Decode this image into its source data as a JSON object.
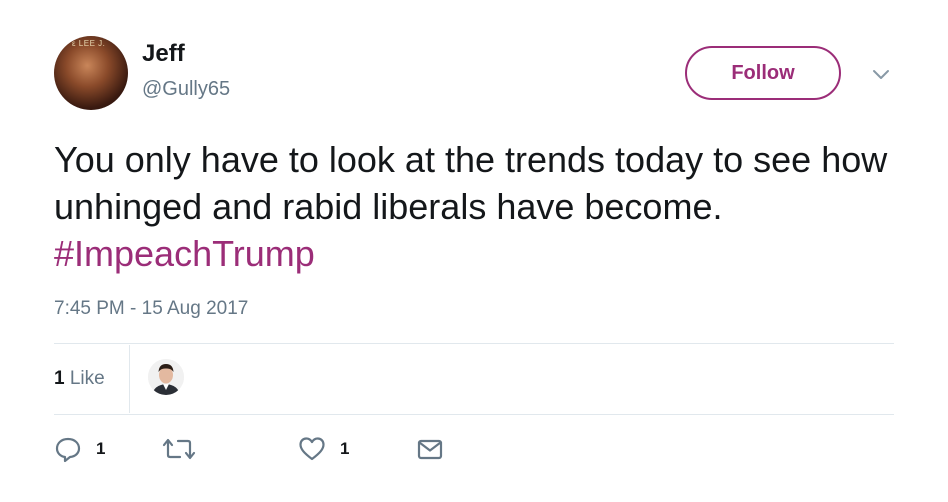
{
  "author": {
    "name": "Jeff",
    "handle": "@Gully65",
    "avatar_text": "ε LEE J."
  },
  "follow_label": "Follow",
  "tweet": {
    "text": "You only have to look at the trends today to see how unhinged and rabid liberals have become.",
    "hashtag": "#ImpeachTrump",
    "timestamp": "7:45 PM - 15 Aug 2017"
  },
  "likes": {
    "count": "1",
    "label": "Like"
  },
  "actions": {
    "reply_count": "1",
    "like_count": "1"
  },
  "colors": {
    "accent": "#9b2d78",
    "text": "#14171a",
    "muted": "#657786",
    "divider": "#e1e8ed"
  },
  "icons": {
    "caret": "chevron-down-icon",
    "reply": "reply-icon",
    "retweet": "retweet-icon",
    "like": "heart-icon",
    "message": "envelope-icon"
  }
}
